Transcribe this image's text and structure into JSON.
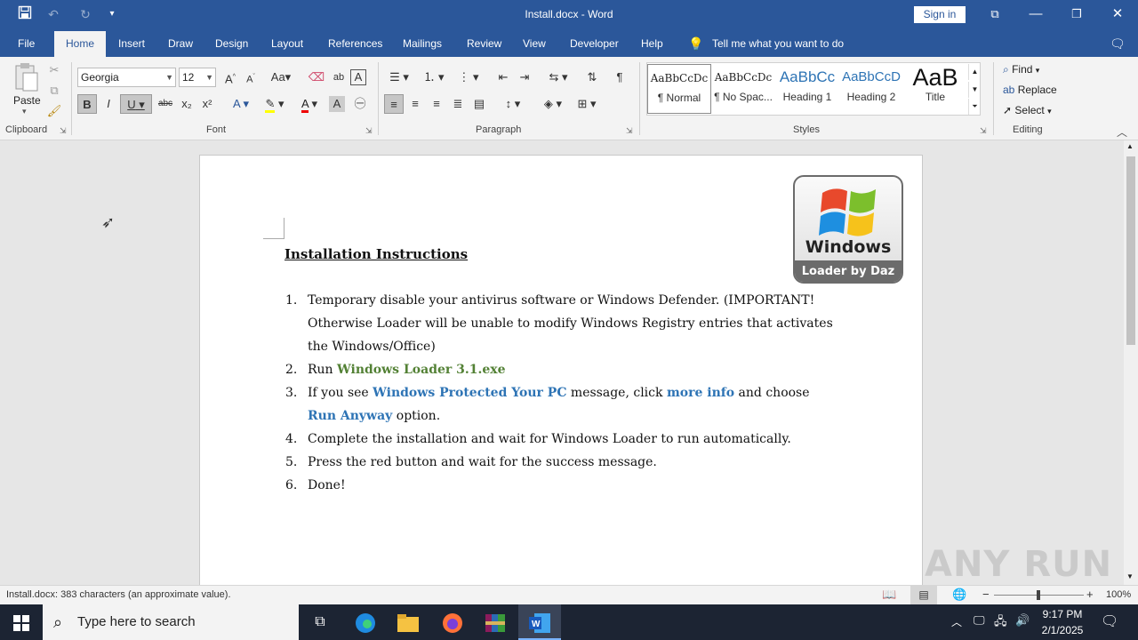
{
  "window": {
    "title": "Install.docx  -  Word",
    "sign_in": "Sign in"
  },
  "tabs": [
    "File",
    "Home",
    "Insert",
    "Draw",
    "Design",
    "Layout",
    "References",
    "Mailings",
    "Review",
    "View",
    "Developer",
    "Help"
  ],
  "tell_me": "Tell me what you want to do",
  "ribbon": {
    "clipboard": {
      "paste": "Paste",
      "label": "Clipboard"
    },
    "font": {
      "family": "Georgia",
      "size": "12",
      "label": "Font",
      "buttons": [
        "B",
        "I",
        "U",
        "abc",
        "x₂",
        "x²"
      ]
    },
    "paragraph": {
      "label": "Paragraph"
    },
    "styles": {
      "label": "Styles",
      "items": [
        {
          "sample": "AaBbCcDc",
          "name": "¶ Normal"
        },
        {
          "sample": "AaBbCcDc",
          "name": "¶ No Spac..."
        },
        {
          "sample": "AaBbCc",
          "name": "Heading 1"
        },
        {
          "sample": "AaBbCcD",
          "name": "Heading 2"
        },
        {
          "sample": "AaB",
          "name": "Title"
        }
      ]
    },
    "editing": {
      "label": "Editing",
      "find": "Find",
      "replace": "Replace",
      "select": "Select"
    }
  },
  "document": {
    "heading": "Installation Instructions",
    "logo": {
      "line1": "Windows",
      "line2": "Loader by Daz"
    },
    "steps": {
      "s1_num": "1.",
      "s1": "Temporary disable your antivirus software or Windows Defender. (IMPORTANT! Otherwise Loader will be unable to modify Windows Registry entries that activates the Windows/Office)",
      "s2_num": "2.",
      "s2_pre": "Run ",
      "s2_hl": "Windows Loader 3.1.exe",
      "s3_num": "3.",
      "s3_pre": "If you see ",
      "s3_hl1": "Windows Protected Your PC",
      "s3_mid": " message, click ",
      "s3_hl2": "more info",
      "s3_mid2": " and choose ",
      "s3_hl3": "Run Anyway",
      "s3_post": " option.",
      "s4_num": "4.",
      "s4": "Complete the installation and wait for Windows Loader to run automatically.",
      "s5_num": "5.",
      "s5": "Press the red button and wait for the success message.",
      "s6_num": "6.",
      "s6": "Done!"
    }
  },
  "status": {
    "text": "Install.docx: 383 characters (an approximate value).",
    "zoom": "100%"
  },
  "taskbar": {
    "search_placeholder": "Type here to search",
    "time": "9:17 PM",
    "date": "2/1/2025"
  },
  "watermark": "ANY RUN",
  "colors": {
    "word_blue": "#2b579a",
    "green_link": "#538135",
    "blue_link": "#2e74b5",
    "taskbar": "#1c2433"
  }
}
